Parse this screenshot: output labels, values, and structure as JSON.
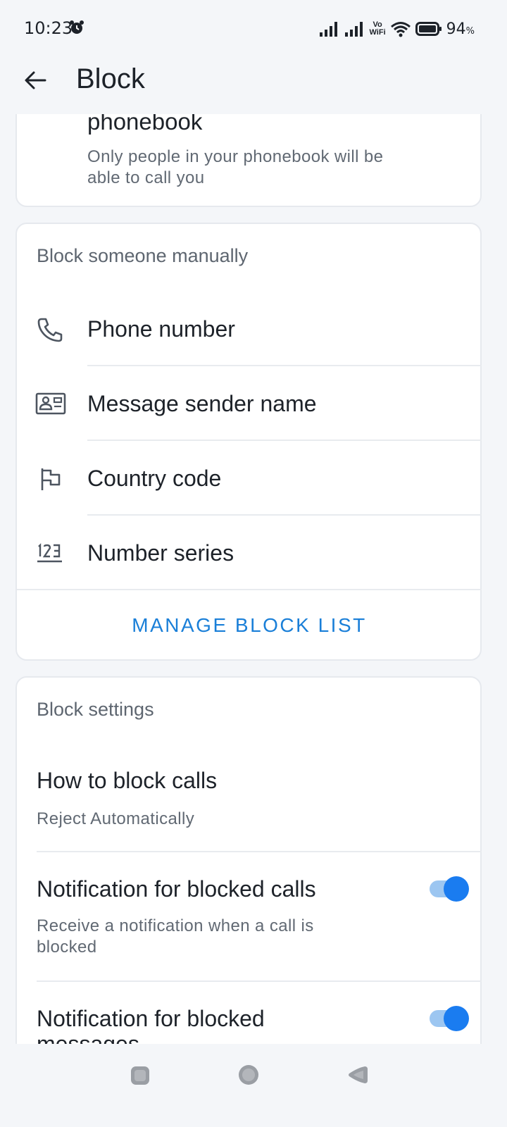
{
  "status_bar": {
    "time": "10:23",
    "vo_label": "Vo",
    "wifi_label": "WiFi",
    "battery_value": "94",
    "battery_unit": "%"
  },
  "app_bar": {
    "title": "Block"
  },
  "phonebook_card": {
    "title_partial": "phonebook",
    "subtitle": "Only people in your phonebook will be able to call you"
  },
  "manual_block": {
    "header": "Block someone manually",
    "items": [
      {
        "label": "Phone number",
        "icon": "phone-icon"
      },
      {
        "label": "Message sender name",
        "icon": "sender-card-icon"
      },
      {
        "label": "Country code",
        "icon": "flag-icon"
      },
      {
        "label": "Number series",
        "icon": "number-series-icon"
      }
    ],
    "manage_button": "MANAGE BLOCK LIST"
  },
  "block_settings": {
    "header": "Block settings",
    "how_to_block": {
      "title": "How to block calls",
      "value": "Reject Automatically"
    },
    "notify_calls": {
      "title": "Notification for blocked calls",
      "subtitle": "Receive a notification when a call is blocked",
      "enabled": true
    },
    "notify_messages": {
      "title": "Notification for blocked messages",
      "enabled": true
    }
  },
  "colors": {
    "accent": "#1a7fd8",
    "toggle_on": "#1a7cf0",
    "background": "#f4f6f9"
  }
}
